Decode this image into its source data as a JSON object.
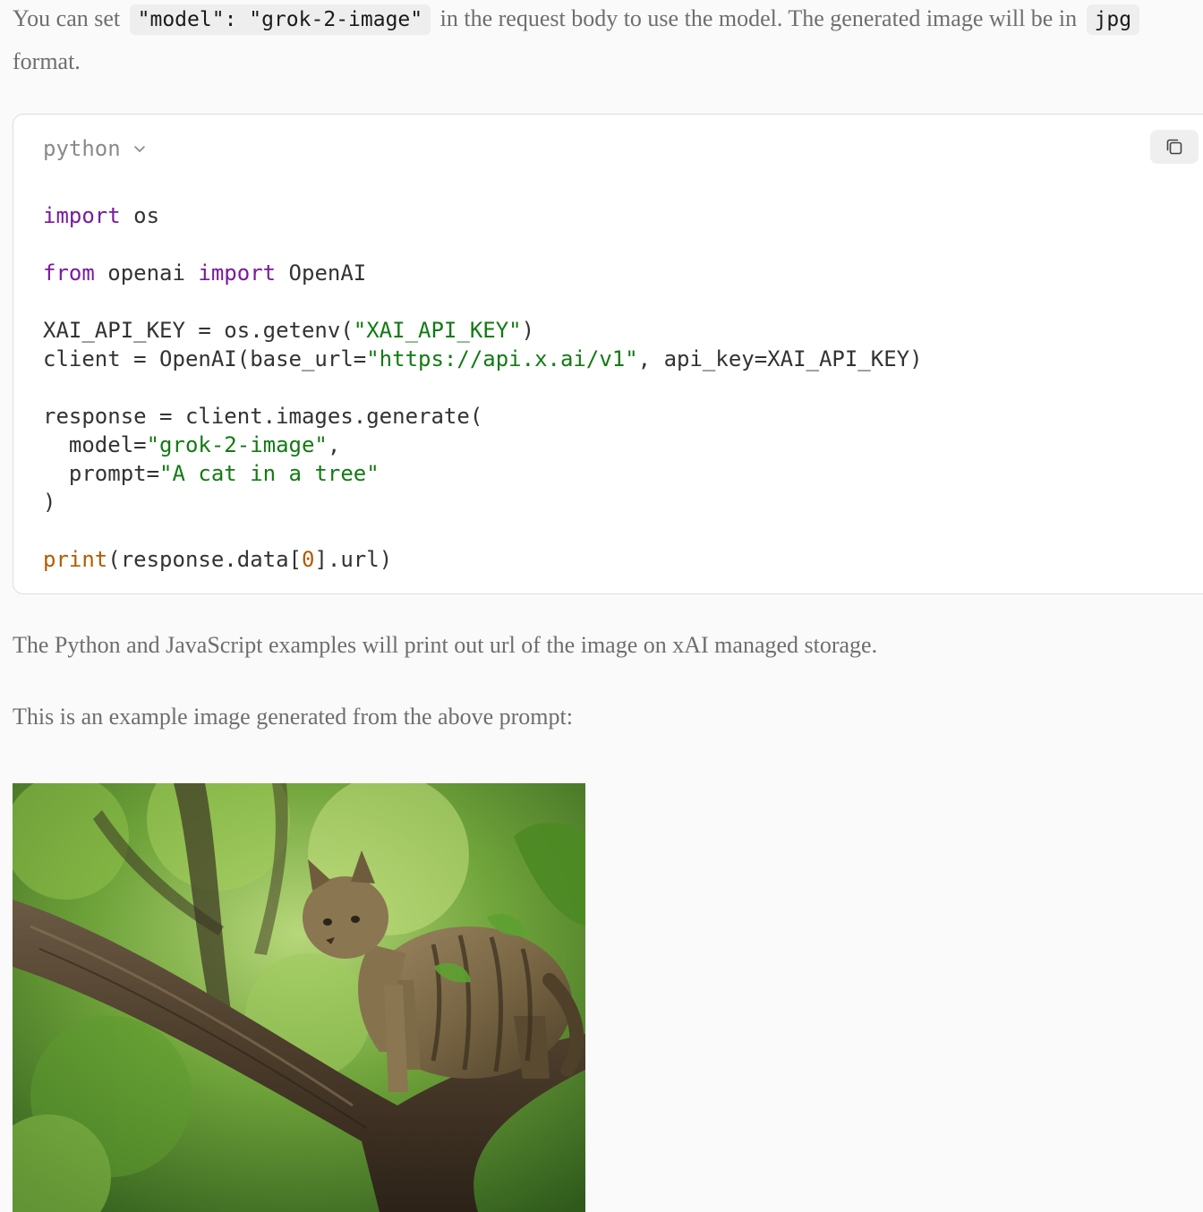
{
  "intro": {
    "before": "You can set",
    "code_model": "\"model\": \"grok-2-image\"",
    "middle": "in the request body to use the model. The generated image will be in",
    "code_format": "jpg",
    "after": "format."
  },
  "code_block": {
    "language": "python",
    "copy_icon": "copy-icon",
    "lines": [
      [
        {
          "t": "import",
          "c": "kw"
        },
        {
          "t": " os",
          "c": ""
        }
      ],
      [],
      [
        {
          "t": "from",
          "c": "kw"
        },
        {
          "t": " openai ",
          "c": ""
        },
        {
          "t": "import",
          "c": "kw"
        },
        {
          "t": " OpenAI",
          "c": ""
        }
      ],
      [],
      [
        {
          "t": "XAI_API_KEY = os.getenv(",
          "c": ""
        },
        {
          "t": "\"XAI_API_KEY\"",
          "c": "str"
        },
        {
          "t": ")",
          "c": ""
        }
      ],
      [
        {
          "t": "client = OpenAI(base_url=",
          "c": ""
        },
        {
          "t": "\"https://api.x.ai/v1\"",
          "c": "str"
        },
        {
          "t": ", api_key=XAI_API_KEY)",
          "c": ""
        }
      ],
      [],
      [
        {
          "t": "response = client.images.generate(",
          "c": ""
        }
      ],
      [
        {
          "t": "  model=",
          "c": ""
        },
        {
          "t": "\"grok-2-image\"",
          "c": "str"
        },
        {
          "t": ",",
          "c": ""
        }
      ],
      [
        {
          "t": "  prompt=",
          "c": ""
        },
        {
          "t": "\"A cat in a tree\"",
          "c": "str"
        }
      ],
      [
        {
          "t": ")",
          "c": ""
        }
      ],
      [],
      [
        {
          "t": "print",
          "c": "fn"
        },
        {
          "t": "(response.data[",
          "c": ""
        },
        {
          "t": "0",
          "c": "num"
        },
        {
          "t": "].url)",
          "c": ""
        }
      ]
    ]
  },
  "paragraph_output": "The Python and JavaScript examples will print out url of the image on xAI managed storage.",
  "paragraph_example": "This is an example image generated from the above prompt:",
  "colors": {
    "keyword": "#7a1a9c",
    "string": "#137a13",
    "builtin": "#b25c00"
  }
}
